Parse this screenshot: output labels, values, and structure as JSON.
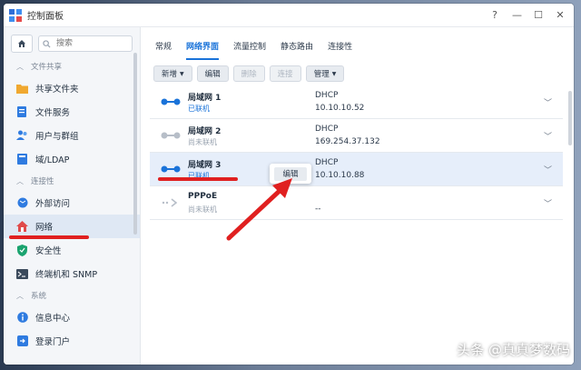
{
  "window": {
    "title": "控制面板"
  },
  "sidebar": {
    "search_placeholder": "搜索",
    "sections": [
      {
        "label": "文件共享",
        "items": [
          {
            "label": "共享文件夹",
            "icon": "folder-icon"
          },
          {
            "label": "文件服务",
            "icon": "file-services-icon"
          },
          {
            "label": "用户与群组",
            "icon": "users-icon"
          },
          {
            "label": "域/LDAP",
            "icon": "domain-icon"
          }
        ]
      },
      {
        "label": "连接性",
        "items": [
          {
            "label": "外部访问",
            "icon": "globe-icon"
          },
          {
            "label": "网络",
            "icon": "network-icon",
            "active": true
          },
          {
            "label": "安全性",
            "icon": "shield-icon"
          },
          {
            "label": "终端机和 SNMP",
            "icon": "terminal-icon"
          }
        ]
      },
      {
        "label": "系统",
        "items": [
          {
            "label": "信息中心",
            "icon": "info-icon"
          },
          {
            "label": "登录门户",
            "icon": "login-portal-icon"
          }
        ]
      }
    ]
  },
  "tabs": [
    {
      "label": "常规"
    },
    {
      "label": "网络界面",
      "active": true
    },
    {
      "label": "流量控制"
    },
    {
      "label": "静态路由"
    },
    {
      "label": "连接性"
    }
  ],
  "toolbar": {
    "create": "新增",
    "edit": "编辑",
    "delete": "删除",
    "connect": "连接",
    "manage": "管理"
  },
  "interfaces": [
    {
      "name": "局域网 1",
      "status": "已联机",
      "connected": true,
      "mode": "DHCP",
      "ip": "10.10.10.52"
    },
    {
      "name": "局域网 2",
      "status": "尚未联机",
      "connected": false,
      "mode": "DHCP",
      "ip": "169.254.37.132"
    },
    {
      "name": "局域网 3",
      "status": "已联机",
      "connected": true,
      "mode": "DHCP",
      "ip": "10.10.10.88",
      "selected": true
    },
    {
      "name": "PPPoE",
      "status": "尚未联机",
      "connected": false,
      "mode": "",
      "ip": "--"
    }
  ],
  "popup": {
    "edit": "编辑"
  },
  "watermark": "头条 @真真梦数码",
  "colors": {
    "accent": "#1a73d9",
    "annotation_red": "#e02020"
  }
}
